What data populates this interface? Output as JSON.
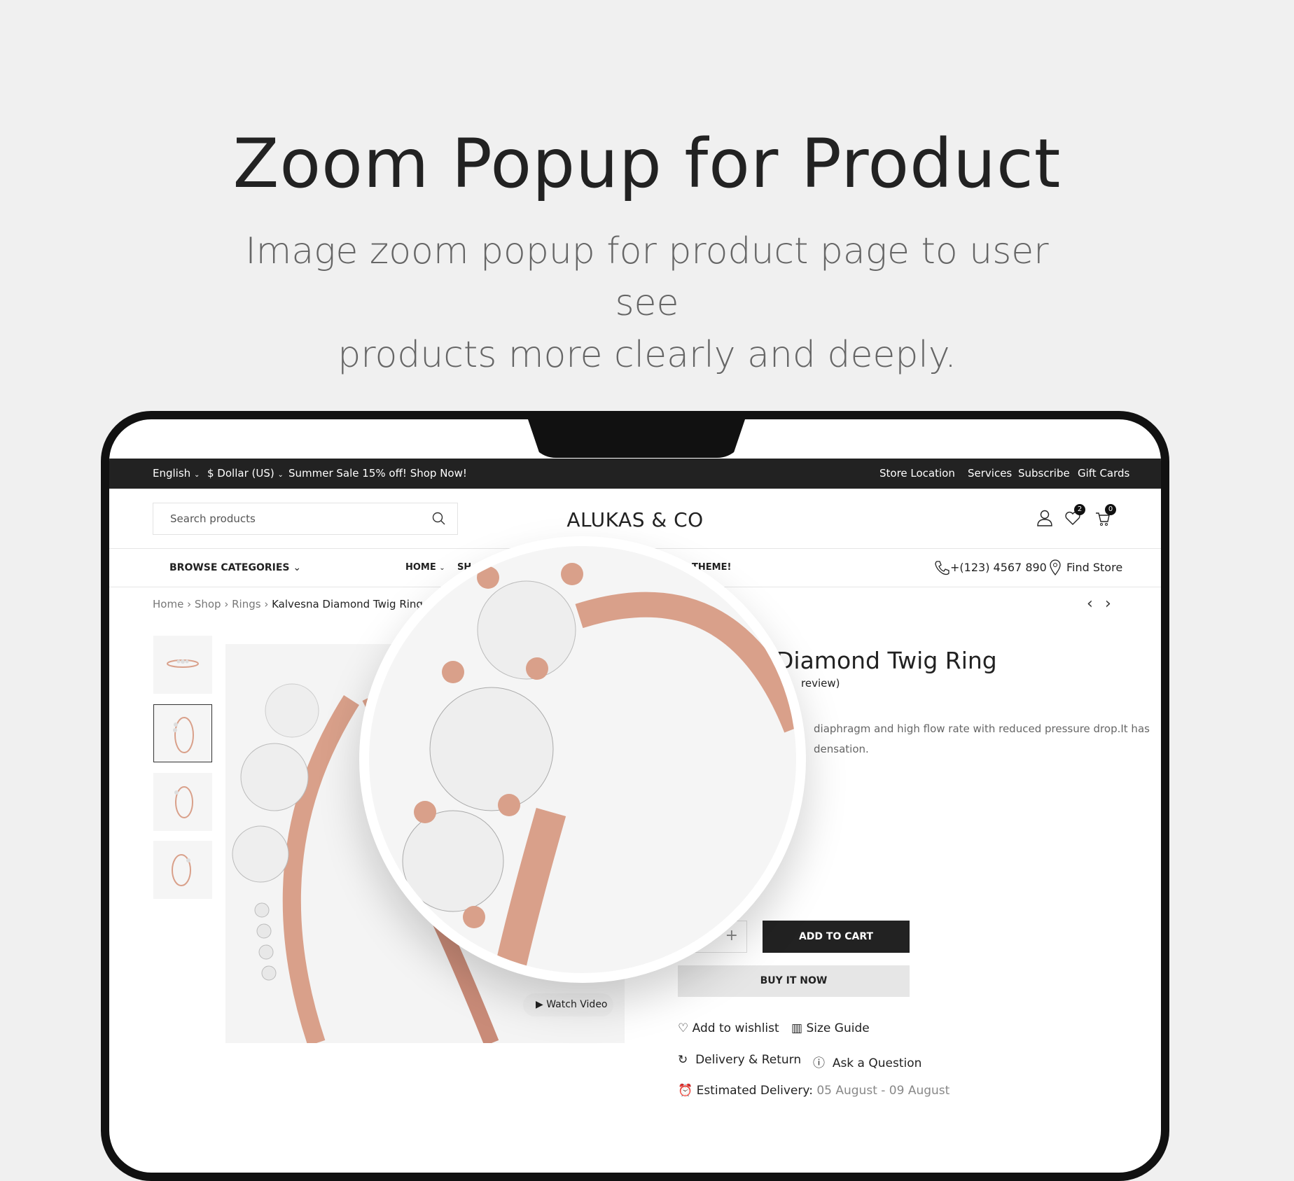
{
  "hero": {
    "title": "Zoom Popup for Product",
    "subtitle_line1": "Image zoom popup for product page to user see",
    "subtitle_line2": "products more clearly and deeply."
  },
  "topbar": {
    "language": "English",
    "currency": "$ Dollar (US)",
    "promo": "Summer Sale 15% off! Shop Now!",
    "links": [
      "Store Location",
      "Services",
      "Subscribe",
      "Gift Cards"
    ]
  },
  "header": {
    "search_placeholder": "Search products",
    "logo": "ALUKAS & CO",
    "wishlist_count": "2",
    "cart_count": "0"
  },
  "nav": {
    "browse": "BROWSE CATEGORIES",
    "home": "HOME",
    "partial_item": "SH",
    "partial_theme": "THEME!",
    "phone": "+(123) 4567 890",
    "find_store": "Find Store"
  },
  "breadcrumb": [
    "Home",
    "Shop",
    "Rings",
    "Kalvesna Diamond Twig Ring"
  ],
  "product": {
    "title_visible": "Diamond Twig Ring",
    "review_visible": "review)",
    "desc_line1": "diaphragm and high flow rate with reduced pressure drop.It has",
    "desc_line2": "densation.",
    "qty_plus": "+",
    "add_to_cart": "ADD TO CART",
    "buy_now": "BUY IT NOW",
    "watch_video": "Watch Video"
  },
  "actions": {
    "wishlist": "Add to wishlist",
    "size_guide": "Size Guide",
    "delivery": "Delivery & Return",
    "ask": "Ask a Question",
    "est_label": "Estimated Delivery:",
    "est_value": "05 August - 09 August"
  },
  "colors": {
    "dark": "#222222",
    "rose_gold": "#d9a08a",
    "bg": "#f0f0f0"
  }
}
